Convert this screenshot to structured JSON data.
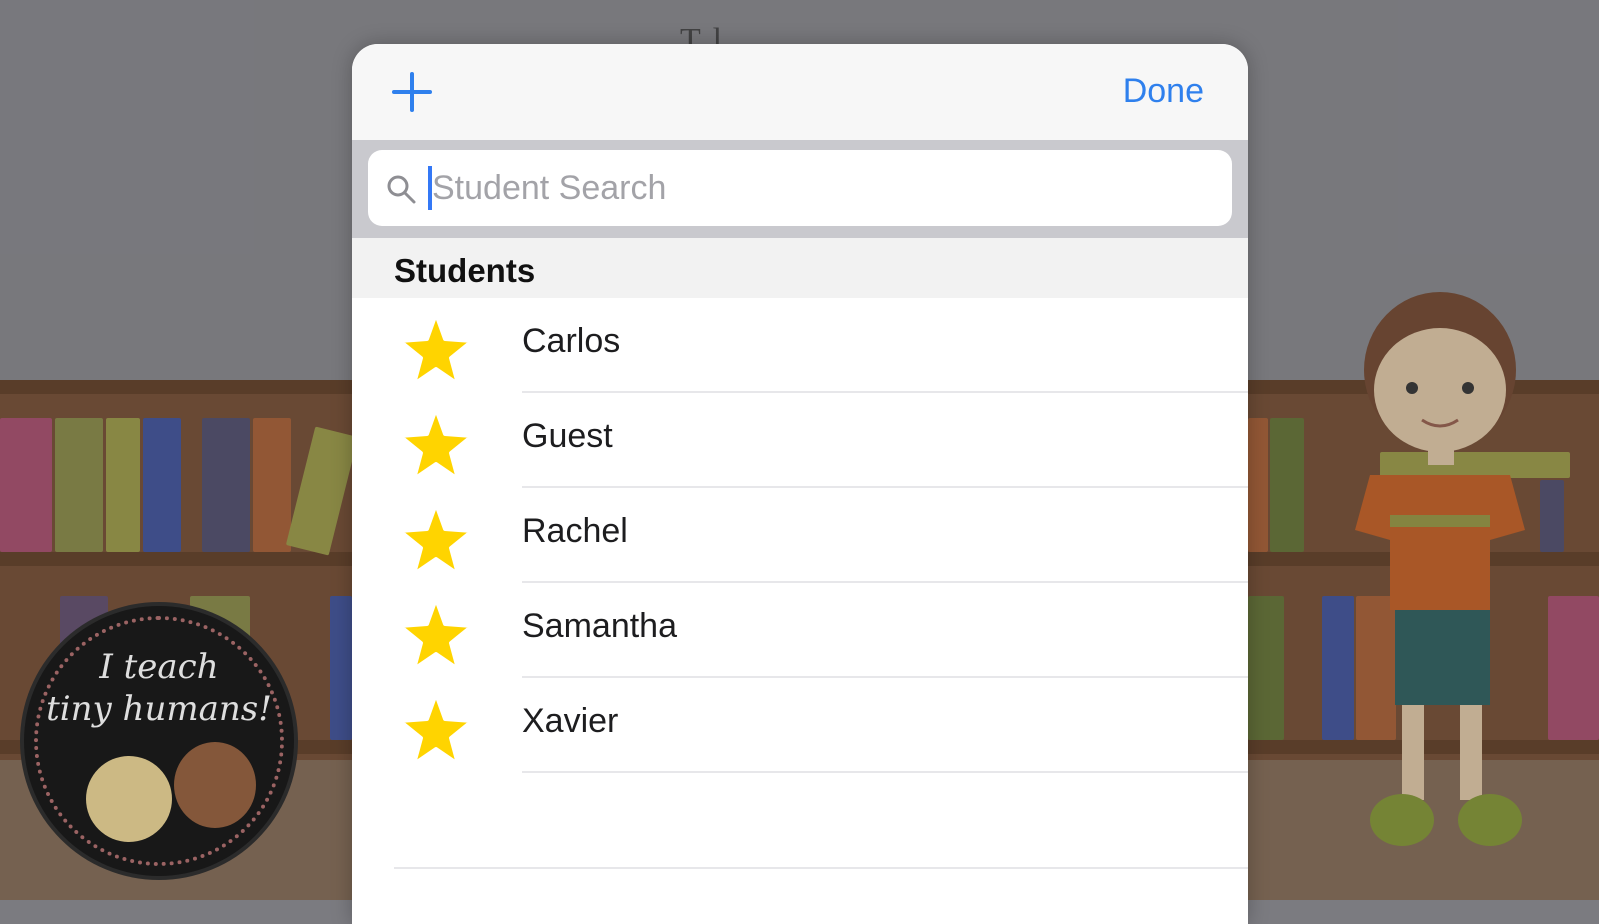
{
  "background": {
    "title": "T   l   ",
    "badge_line1": "I teach",
    "badge_line2": "tiny humans!"
  },
  "modal": {
    "add_icon": "plus-icon",
    "done_label": "Done",
    "search": {
      "placeholder": "Student Search",
      "value": "",
      "icon": "search-icon"
    },
    "section_title": "Students",
    "students": [
      {
        "name": "Carlos",
        "icon": "star-icon"
      },
      {
        "name": "Guest",
        "icon": "star-icon"
      },
      {
        "name": "Rachel",
        "icon": "star-icon"
      },
      {
        "name": "Samantha",
        "icon": "star-icon"
      },
      {
        "name": "Xavier",
        "icon": "star-icon"
      }
    ]
  },
  "colors": {
    "accent": "#2f80ed",
    "star": "#ffd400",
    "search_bar_bg": "#c9c9ce"
  }
}
